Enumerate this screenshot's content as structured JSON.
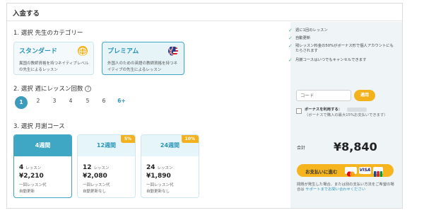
{
  "header": {
    "title": "入金する"
  },
  "section1": {
    "title": "1. 選択 先生のカテゴリー",
    "standard": {
      "name": "スタンダード",
      "desc": "異国の教師資格を持つネイティブレベルの先生によるレッスン"
    },
    "premium": {
      "name": "プレミアム",
      "desc": "外国人のための英語の教師資格を持つネイティブの先生によるレッスン"
    }
  },
  "section2": {
    "title": "2. 選択 週にレッスン回数",
    "help_icon": "question-circle-icon",
    "options": [
      "1",
      "2",
      "3",
      "4",
      "5",
      "6",
      "6+"
    ],
    "selected": "1"
  },
  "section3": {
    "title": "3. 選択 月謝コース",
    "courses": [
      {
        "label": "4週間",
        "badge": "",
        "lessons": "4",
        "lessons_unit": "レッスン",
        "price": "¥2,210",
        "note": "一回レッスン代",
        "renew": "自動更新"
      },
      {
        "label": "12週間",
        "badge": "5%",
        "lessons": "12",
        "lessons_unit": "レッスン",
        "price": "¥2,080",
        "note": "一回レッスン代",
        "renew": "自動更新なし"
      },
      {
        "label": "24週間",
        "badge": "10%",
        "lessons": "24",
        "lessons_unit": "レッスン",
        "price": "¥1,890",
        "note": "一回レッスン代",
        "renew": "自動更新なし"
      }
    ]
  },
  "sidebar": {
    "features": [
      "週に1回のレッスン",
      "自動更新",
      "残レッスン料金の50%がボーナス形で個人アカウントにもたらされます",
      "月謝コースはいつでもキャンセルできます"
    ],
    "code_placeholder": "コード",
    "apply_label": "適用",
    "bonus_label": "ボーナスを利用する：",
    "bonus_note": "（ボーナスで購入の最大15%お支払いできます）",
    "total_label": "合計",
    "total_value": "¥8,840",
    "pay_label": "お支払いに進む",
    "footer_text": "問題が発生した場合、または別の支払い方法をご希望の場合は ",
    "footer_link": "サポートまでお問い合わせください",
    "accent": "#f3b11c",
    "brand": "#3fa6c3"
  }
}
